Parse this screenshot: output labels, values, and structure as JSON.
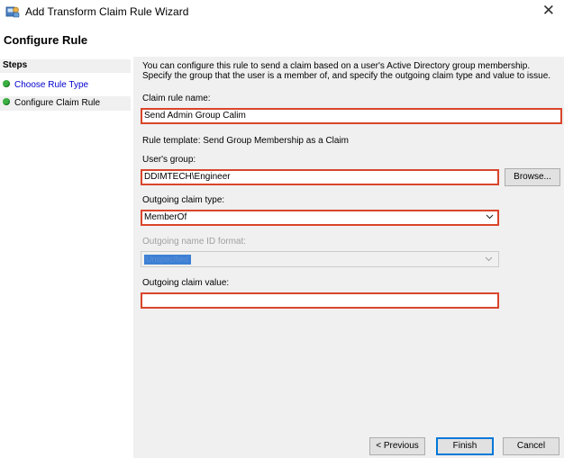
{
  "window": {
    "title": "Add Transform Claim Rule Wizard",
    "close_glyph": "✕",
    "icon": "wizard-app-icon"
  },
  "header": {
    "title": "Configure Rule"
  },
  "steps": {
    "heading": "Steps",
    "items": [
      {
        "label": "Choose Rule Type",
        "state": "link"
      },
      {
        "label": "Configure Claim Rule",
        "state": "current"
      }
    ],
    "dot_color": "#3cb043"
  },
  "form": {
    "description": "You can configure this rule to send a claim based on a user's Active Directory group membership. Specify the group that the user is a member of, and specify the outgoing claim type and value to issue.",
    "rule_name_label": "Claim rule name:",
    "rule_name_value": "Send Admin Group Calim",
    "rule_template": "Rule template: Send Group Membership as a Claim",
    "users_group_label": "User's group:",
    "users_group_value": "DDIMTECH\\Engineer",
    "browse_label": "Browse...",
    "claim_type_label": "Outgoing claim type:",
    "claim_type_value": "MemberOf",
    "name_id_label": "Outgoing name ID format:",
    "name_id_value": "Unspecified",
    "claim_value_label": "Outgoing claim value:",
    "claim_value_value": ""
  },
  "buttons": {
    "previous": "< Previous",
    "finish": "Finish",
    "cancel": "Cancel"
  },
  "colors": {
    "highlight_border": "#d9452b",
    "panel_bg": "#f0f0f0",
    "accent": "#0078d7"
  }
}
